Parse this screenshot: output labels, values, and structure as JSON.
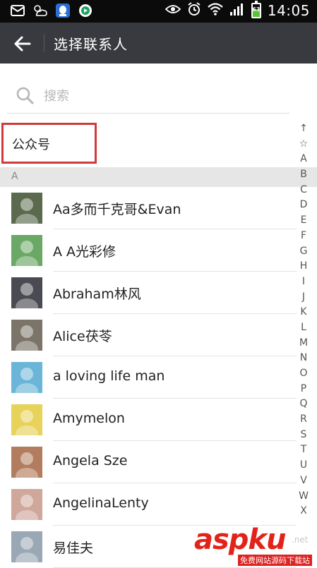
{
  "status_bar": {
    "time": "14:05",
    "battery_level": "63",
    "battery_fraction": 0.63,
    "left_icons": [
      "mail-icon",
      "weather-icon",
      "messenger-icon",
      "video-app-icon"
    ],
    "right_icons": [
      "eye-icon",
      "alarm-icon",
      "wifi-icon",
      "signal-icon",
      "battery-icon"
    ]
  },
  "header": {
    "title": "选择联系人",
    "back_icon": "back-arrow-icon"
  },
  "search": {
    "placeholder": "搜索",
    "icon": "search-icon"
  },
  "official_accounts": {
    "label": "公众号"
  },
  "section": {
    "letter": "A"
  },
  "contacts": [
    {
      "name": "Aa多而千克哥&Evan",
      "avatar_color": "#5b6a4f"
    },
    {
      "name": "A  A光彩修",
      "avatar_color": "#6aa865"
    },
    {
      "name": "Abraham林风",
      "avatar_color": "#4a4a52"
    },
    {
      "name": "Alice茯苓",
      "avatar_color": "#7b7468"
    },
    {
      "name": "a loving life man",
      "avatar_color": "#6bb6d8"
    },
    {
      "name": "Amymelon",
      "avatar_color": "#e7d25a"
    },
    {
      "name": "Angela Sze",
      "avatar_color": "#b27d5e"
    },
    {
      "name": "AngelinaLenty",
      "avatar_color": "#cfa79b"
    },
    {
      "name": "易佳夫",
      "avatar_color": "#9aa7b4"
    }
  ],
  "index_letters": [
    "↑",
    "☆",
    "A",
    "B",
    "C",
    "D",
    "E",
    "F",
    "G",
    "H",
    "I",
    "J",
    "K",
    "L",
    "M",
    "N",
    "O",
    "P",
    "Q",
    "R",
    "S",
    "T",
    "U",
    "V",
    "W",
    "X"
  ],
  "watermark": {
    "brand": "aspku",
    "net": ".net",
    "subtitle": "免费网站源码下载站"
  },
  "colors": {
    "topbar": "#393a3f",
    "official_border": "#d03a3a",
    "watermark_red": "#e2231a"
  }
}
